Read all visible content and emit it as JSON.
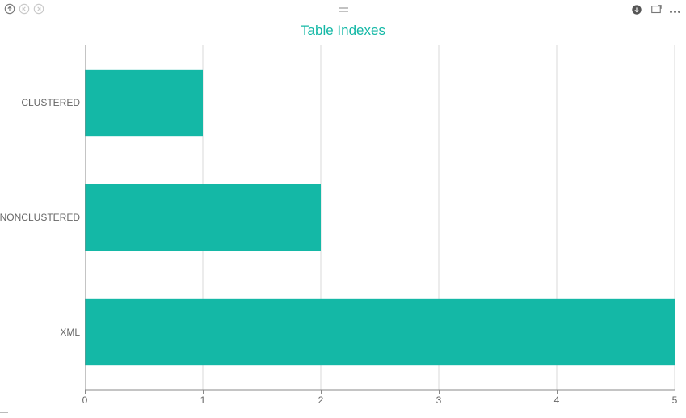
{
  "toolbar": {
    "icons": {
      "up": "arrow-up-circle-icon",
      "prev": "skip-back-circle-icon",
      "next": "skip-forward-circle-icon",
      "center": "drag-handle-icon",
      "down": "arrow-down-circle-icon",
      "focus": "focus-mode-icon",
      "more": "more-options-icon"
    }
  },
  "chart_data": {
    "type": "bar",
    "orientation": "horizontal",
    "title": "Table Indexes",
    "title_color": "#14b8a6",
    "bar_color": "#14b8a6",
    "categories": [
      "CLUSTERED",
      "NONCLUSTERED",
      "XML"
    ],
    "values": [
      1,
      2,
      5
    ],
    "xlabel": "",
    "ylabel": "",
    "xlim": [
      0,
      5
    ],
    "xticks": [
      0,
      1,
      2,
      3,
      4,
      5
    ],
    "grid": true
  }
}
